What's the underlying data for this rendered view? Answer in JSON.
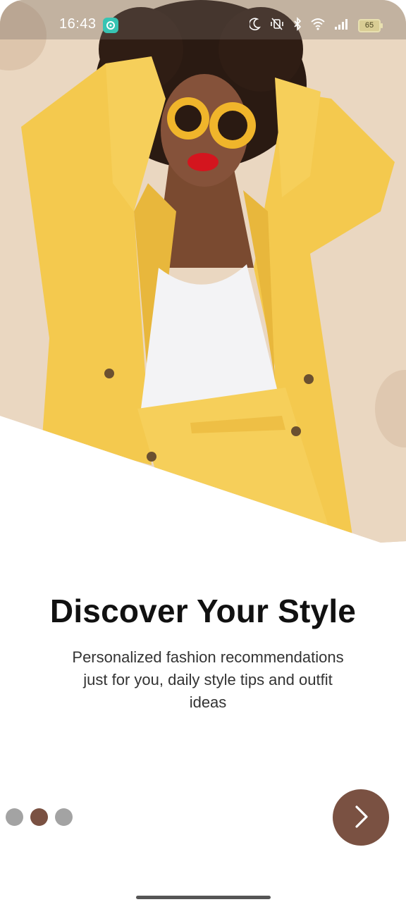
{
  "status_bar": {
    "time": "16:43",
    "battery_level": "65",
    "icons": [
      "app-notification-icon",
      "do-not-disturb-moon-icon",
      "vibrate-off-icon",
      "bluetooth-icon",
      "wifi-icon",
      "cellular-signal-icon",
      "battery-icon"
    ]
  },
  "hero": {
    "image": "woman-in-yellow-suit-photo",
    "background_color": "#ead7c1"
  },
  "onboarding": {
    "title": "Discover Your Style",
    "subtitle": "Personalized fashion recommendations just for you, daily style tips and outfit ideas"
  },
  "pager": {
    "total_pages": 3,
    "current_page": 2
  },
  "next_button": {
    "icon": "chevron-right-icon",
    "color": "#7a5142"
  },
  "colors": {
    "accent": "#7a5142",
    "inactive_dot": "#a3a3a3"
  }
}
